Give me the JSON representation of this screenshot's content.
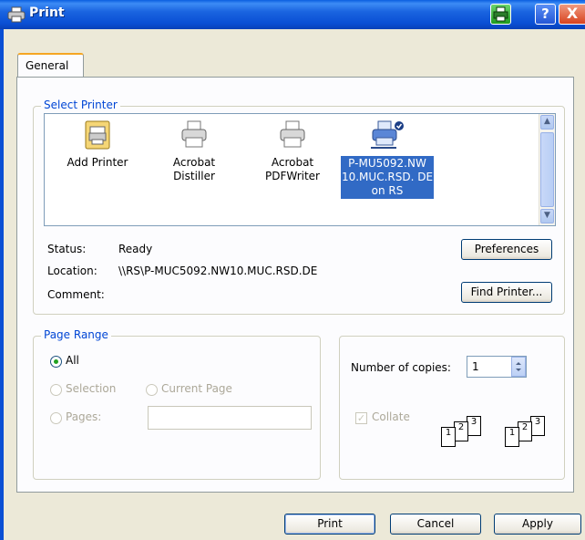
{
  "window": {
    "title": "Print"
  },
  "title_buttons": {
    "help": "?",
    "close": "X"
  },
  "tabs": [
    {
      "label": "General"
    }
  ],
  "select_printer": {
    "group_label": "Select Printer",
    "printers": [
      {
        "label": "Add Printer",
        "icon": "add-printer-icon",
        "selected": false
      },
      {
        "label": "Acrobat Distiller",
        "icon": "printer-icon",
        "selected": false
      },
      {
        "label": "Acrobat PDFWriter",
        "icon": "printer-icon",
        "selected": false
      },
      {
        "label": "P-MU5092.NW 10.MUC.RSD. DE on RS",
        "icon": "network-printer-icon",
        "selected": true
      }
    ],
    "status_label": "Status:",
    "status_value": "Ready",
    "location_label": "Location:",
    "location_value": "\\\\RS\\P-MUC5092.NW10.MUC.RSD.DE",
    "comment_label": "Comment:",
    "comment_value": "",
    "preferences_button": "Preferences",
    "find_printer_button": "Find Printer..."
  },
  "page_range": {
    "group_label": "Page Range",
    "all_label": "All",
    "selection_label": "Selection",
    "current_page_label": "Current Page",
    "pages_label": "Pages:",
    "pages_value": "",
    "selected": "All"
  },
  "copies": {
    "number_label": "Number of copies:",
    "number_value": "1",
    "collate_label": "Collate",
    "collate_checked": true,
    "collate_enabled": false,
    "page_numbers": [
      "1",
      "2",
      "3"
    ]
  },
  "footer": {
    "print_button": "Print",
    "cancel_button": "Cancel",
    "apply_button": "Apply"
  },
  "colors": {
    "titlebar": "#0a4fd4",
    "group_label": "#0046d5",
    "selection_highlight": "#316ac5",
    "dialog_bg": "#ece9d8"
  }
}
